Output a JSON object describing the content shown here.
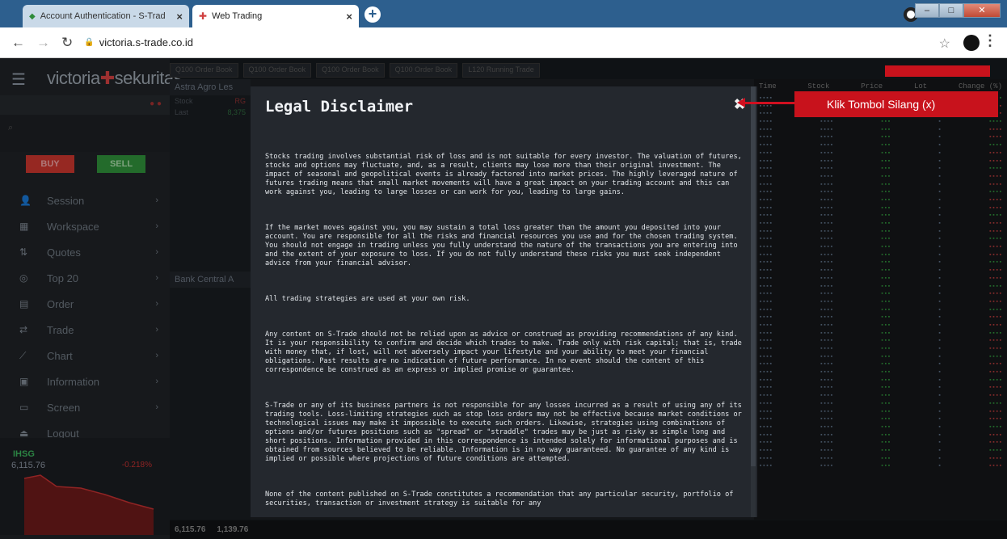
{
  "browser": {
    "tabs": [
      {
        "title": "Account Authentication - S-Trad"
      },
      {
        "title": "Web Trading"
      }
    ],
    "url": "victoria.s-trade.co.id"
  },
  "app": {
    "logo_left": "victoria",
    "logo_right": "sekuritas",
    "buy_label": "BUY",
    "sell_label": "SELL",
    "menu": [
      {
        "label": "Session",
        "icon": "person-icon"
      },
      {
        "label": "Workspace",
        "icon": "grid-icon"
      },
      {
        "label": "Quotes",
        "icon": "quotes-icon"
      },
      {
        "label": "Top 20",
        "icon": "top20-icon"
      },
      {
        "label": "Order",
        "icon": "order-icon"
      },
      {
        "label": "Trade",
        "icon": "trade-icon"
      },
      {
        "label": "Chart",
        "icon": "chart-icon"
      },
      {
        "label": "Information",
        "icon": "info-icon"
      },
      {
        "label": "Screen",
        "icon": "screen-icon"
      },
      {
        "label": "Logout",
        "icon": "logout-icon"
      }
    ],
    "ihsg": {
      "name": "IHSG",
      "value": "6,115.76",
      "change_pct": "-0.218%"
    },
    "panel_tabs": [
      "Q100 Order Book",
      "Q100 Order Book",
      "Q100 Order Book",
      "Q100 Order Book",
      "L120 Running Trade"
    ],
    "stock1": "Astra Agro Les",
    "stock2": "Bank Central A",
    "last1": "8,375",
    "bottom_idx": "6,115.76",
    "bottom_idx2": "1,139.76"
  },
  "modal": {
    "title": "Legal Disclaimer",
    "paragraphs": [
      "Stocks trading involves substantial risk of loss and is not suitable for every investor. The valuation of futures, stocks and options may fluctuate, and, as a result, clients may lose more than their original investment. The impact of seasonal and geopolitical events is already factored into market prices. The highly leveraged nature of futures trading means that small market movements will have a great impact on your trading account and this can work against you, leading to large losses or can work for you, leading to large gains.",
      "If the market moves against you, you may sustain a total loss greater than the amount you deposited into your account. You are responsible for all the risks and financial resources you use and for the chosen trading system. You should not engage in trading unless you fully understand the nature of the transactions you are entering into and the extent of your exposure to loss. If you do not fully understand these risks you must seek independent advice from your financial advisor.",
      "All trading strategies are used at your own risk.",
      "Any content on S-Trade should not be relied upon as advice or construed as providing recommendations of any kind. It is your responsibility to confirm and decide which trades to make. Trade only with risk capital; that is, trade with money that, if lost, will not adversely impact your lifestyle and your ability to meet your financial obligations. Past results are no indication of future performance. In no event should the content of this correspondence be construed as an express or implied promise or guarantee.",
      "S-Trade or any of its business partners is not responsible for any losses incurred as a result of using any of its trading tools. Loss-limiting strategies such as stop loss orders may not be effective because market conditions or technological issues may make it impossible to execute such orders. Likewise, strategies using combinations of options and/or futures positions such as \"spread\" or \"straddle\" trades may be just as risky as simple long and short positions. Information provided in this correspondence is intended solely for informational purposes and is obtained from sources believed to be reliable. Information is in no way guaranteed. No guarantee of any kind is implied or possible where projections of future conditions are attempted.",
      "None of the content published on S-Trade constitutes a recommendation that any particular security, portfolio of securities, transaction or investment strategy is suitable for any"
    ]
  },
  "annotation": {
    "label": "Klik Tombol Silang (x)",
    "color": "#c8121c"
  }
}
